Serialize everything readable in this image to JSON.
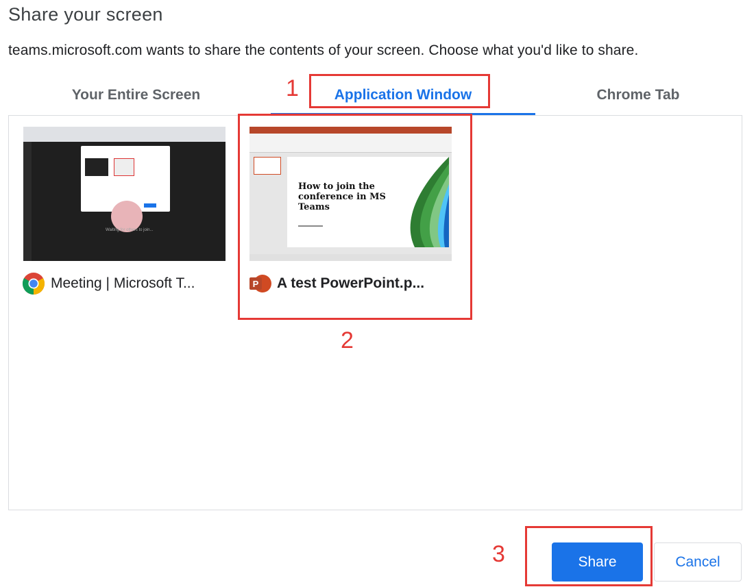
{
  "dialog": {
    "title": "Share your screen",
    "subtitle": "teams.microsoft.com wants to share the contents of your screen. Choose what you'd like to share."
  },
  "tabs": [
    {
      "label": "Your Entire Screen",
      "selected": false
    },
    {
      "label": "Application Window",
      "selected": true
    },
    {
      "label": "Chrome Tab",
      "selected": false
    }
  ],
  "sources": [
    {
      "label": "Meeting | Microsoft T...",
      "icon": "chrome-icon",
      "selected": false,
      "thumbnail": {
        "waiting_text": "Waiting for others to join..."
      }
    },
    {
      "label": "A test PowerPoint.p...",
      "icon": "powerpoint-icon",
      "selected": true,
      "thumbnail": {
        "slide_title": "How to join the conference in MS Teams"
      }
    }
  ],
  "buttons": {
    "share": "Share",
    "cancel": "Cancel"
  },
  "annotations": [
    "1",
    "2",
    "3"
  ],
  "colors": {
    "accent": "#1a73e8",
    "annotation": "#e53935",
    "powerpoint": "#d04a23"
  }
}
